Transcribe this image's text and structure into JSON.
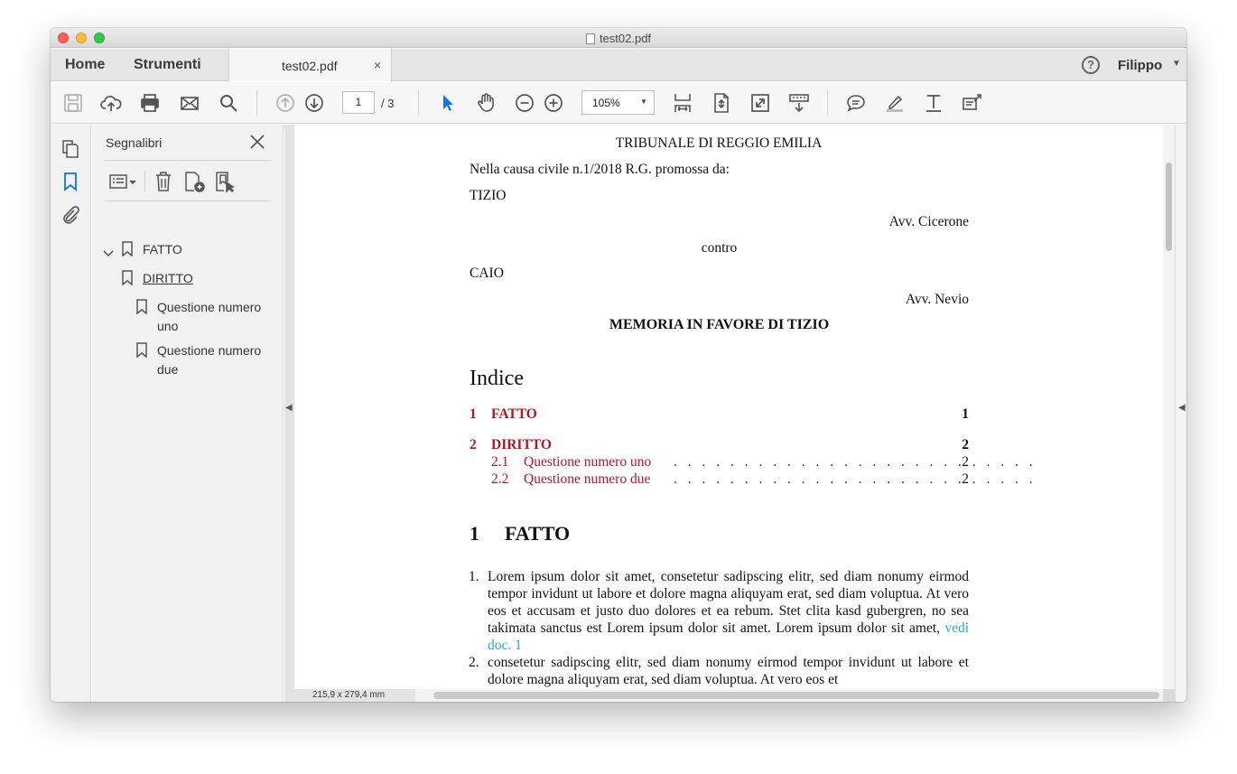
{
  "window": {
    "title": "test02.pdf"
  },
  "tabbar": {
    "home": "Home",
    "tools": "Strumenti",
    "doc_tab": "test02.pdf",
    "doc_tab_close": "×",
    "help": "?",
    "user": "Filippo"
  },
  "toolbar": {
    "icons": [
      "save-icon",
      "cloud-upload-icon",
      "print-icon",
      "mail-icon",
      "search-icon",
      "page-up-icon",
      "page-down-icon",
      "select-cursor-icon",
      "hand-icon",
      "zoom-out-icon",
      "zoom-in-icon",
      "fit-width-icon",
      "rotate-icon",
      "fullscreen-icon",
      "scroll-mode-icon",
      "comment-icon",
      "highlight-icon",
      "text-icon",
      "fill-sign-icon"
    ],
    "page_current": "1",
    "page_total": "/ 3",
    "zoom": "105%"
  },
  "sidebar": {
    "rail_icons": [
      "pages-icon",
      "bookmark-icon",
      "attachment-icon"
    ],
    "panel_title": "Segnalibri",
    "bookmarks": [
      {
        "label": "FATTO",
        "level": 1
      },
      {
        "label": "DIRITTO",
        "level": 1,
        "expanded": true
      },
      {
        "label": "Questione numero",
        "label2": "uno",
        "level": 2
      },
      {
        "label": "Questione numero",
        "label2": "due",
        "level": 2
      }
    ]
  },
  "document": {
    "court": "TRIBUNALE DI REGGIO EMILIA",
    "case_line": "Nella causa civile n.1/2018 R.G. promossa da:",
    "party1": "TIZIO",
    "lawyer1": "Avv. Cicerone",
    "versus": "contro",
    "party2": "CAIO",
    "lawyer2": "Avv. Nevio",
    "memo_title": "MEMORIA IN FAVORE DI TIZIO",
    "toc_title": "Indice",
    "toc": [
      {
        "num": "1",
        "title": "FATTO",
        "page": "1"
      },
      {
        "num": "2",
        "title": "DIRITTO",
        "page": "2"
      },
      {
        "num": "2.1",
        "title": "Questione numero uno",
        "page": "2"
      },
      {
        "num": "2.2",
        "title": "Questione numero due",
        "page": "2"
      }
    ],
    "section1_num": "1",
    "section1_title": "FATTO",
    "items": [
      {
        "num": "1.",
        "text": "Lorem ipsum dolor sit amet, consetetur sadipscing elitr, sed diam nonumy eirmod tempor invidunt ut labore et dolore magna aliquyam erat, sed diam voluptua. At vero eos et accusam et justo duo dolores et ea rebum. Stet clita kasd gubergren, no sea takimata sanctus est Lorem ipsum dolor sit amet. Lorem ipsum dolor sit amet,",
        "link": "vedi doc. 1"
      },
      {
        "num": "2.",
        "text": "consetetur sadipscing elitr, sed diam nonumy eirmod tempor invidunt ut labore et dolore magna aliquyam erat, sed diam voluptua. At vero eos et"
      }
    ],
    "dots": ". . . . . . . . . . . . . . . . . . . . . . . . . .",
    "page_size": "215,9 x 279,4 mm"
  },
  "colors": {
    "link_red": "#b8122b",
    "link_blue": "#2aa9df",
    "accent_blue": "#1473e6"
  }
}
